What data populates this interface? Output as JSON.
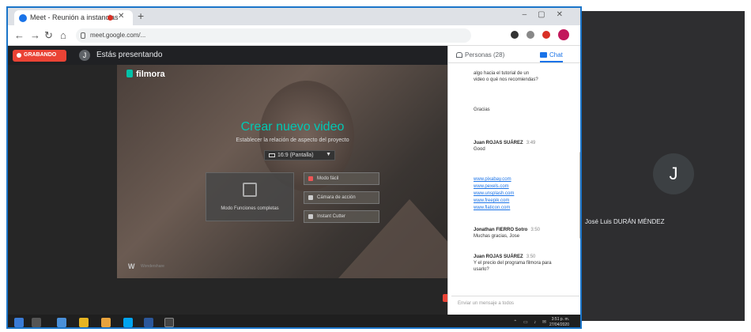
{
  "browser": {
    "tab_title": "Meet - Reunión a instancias",
    "url": "meet.google.com/..."
  },
  "meet": {
    "rec_label": "GRABANDO",
    "presenter_initial": "J",
    "presenting_text": "Estás presentando"
  },
  "filmora": {
    "logo": "filmora",
    "title": "Crear nuevo video",
    "subtitle": "Establecer la relación de aspecto del proyecto",
    "aspect_value": "16:9 (Pantalla)",
    "mode_full": "Modo Funciones completas",
    "mode_easy": "Modo fácil",
    "mode_action": "Cámara de acción",
    "mode_instant": "Instant Cutter",
    "brand": "Wondershare"
  },
  "chat": {
    "people_tab": "Personas (28)",
    "chat_tab": "Chat",
    "messages": [
      {
        "text": "algo hacia el tutorial de un"
      },
      {
        "text": "video o qué nos recomiendas?"
      },
      {
        "text": "Gracias"
      },
      {
        "sender": "Juan ROJAS SUÁREZ",
        "time": "3:49"
      },
      {
        "text": "Good"
      },
      {
        "link": "www.pixabay.com"
      },
      {
        "link": "www.pexels.com"
      },
      {
        "link": "www.unsplash.com"
      },
      {
        "link": "www.freepik.com"
      },
      {
        "link": "www.flaticon.com"
      },
      {
        "sender": "Jonathan FIERRO Sotro",
        "time": "3:50"
      },
      {
        "text": "Muchas gracias, Jose"
      },
      {
        "sender": "Juan ROJAS SUÁREZ",
        "time": "3:50"
      },
      {
        "text": "Y el precio del programa filmora para"
      },
      {
        "text": "usarlo?"
      }
    ],
    "input_placeholder": "Enviar un mensaje a todos"
  },
  "taskbar": {
    "clock_time": "3:51 p. m.",
    "clock_date": "27/04/2020"
  },
  "participant": {
    "initial": "J",
    "name": "José Luis DURÁN MÉNDEZ"
  }
}
